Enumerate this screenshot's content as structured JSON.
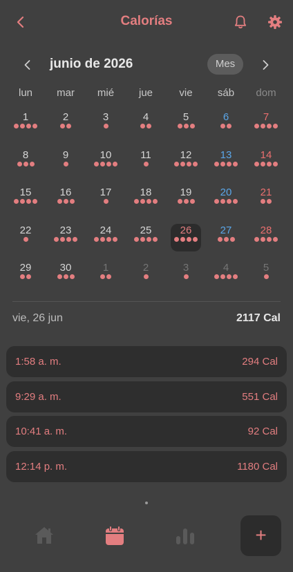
{
  "header": {
    "title": "Calorías",
    "back_icon": "chevron-left-icon",
    "bell_icon": "bell-icon",
    "gear_icon": "gear-icon",
    "accent": "#e37e80"
  },
  "calendar": {
    "month_label": "junio de 2026",
    "view_toggle": "Mes",
    "weekdays": [
      "lun",
      "mar",
      "mié",
      "jue",
      "vie",
      "sáb",
      "dom"
    ],
    "selected_day": 26,
    "weeks": [
      [
        {
          "d": "1",
          "dots": 4
        },
        {
          "d": "2",
          "dots": 2
        },
        {
          "d": "3",
          "dots": 1
        },
        {
          "d": "4",
          "dots": 2
        },
        {
          "d": "5",
          "dots": 3
        },
        {
          "d": "6",
          "dots": 2
        },
        {
          "d": "7",
          "dots": 4
        }
      ],
      [
        {
          "d": "8",
          "dots": 3
        },
        {
          "d": "9",
          "dots": 1
        },
        {
          "d": "10",
          "dots": 4
        },
        {
          "d": "11",
          "dots": 1
        },
        {
          "d": "12",
          "dots": 4
        },
        {
          "d": "13",
          "dots": 4
        },
        {
          "d": "14",
          "dots": 4
        }
      ],
      [
        {
          "d": "15",
          "dots": 4
        },
        {
          "d": "16",
          "dots": 3
        },
        {
          "d": "17",
          "dots": 1
        },
        {
          "d": "18",
          "dots": 4
        },
        {
          "d": "19",
          "dots": 3
        },
        {
          "d": "20",
          "dots": 4
        },
        {
          "d": "21",
          "dots": 2
        }
      ],
      [
        {
          "d": "22",
          "dots": 1
        },
        {
          "d": "23",
          "dots": 4
        },
        {
          "d": "24",
          "dots": 4
        },
        {
          "d": "25",
          "dots": 4
        },
        {
          "d": "26",
          "dots": 4
        },
        {
          "d": "27",
          "dots": 3
        },
        {
          "d": "28",
          "dots": 4
        }
      ],
      [
        {
          "d": "29",
          "dots": 2
        },
        {
          "d": "30",
          "dots": 3
        },
        {
          "d": "1",
          "dots": 2,
          "other": true
        },
        {
          "d": "2",
          "dots": 1,
          "other": true
        },
        {
          "d": "3",
          "dots": 1,
          "other": true
        },
        {
          "d": "4",
          "dots": 4,
          "other": true
        },
        {
          "d": "5",
          "dots": 1,
          "other": true
        }
      ]
    ],
    "colors": {
      "weekday": "#d6d6d6",
      "saturday": "#5aa6e8",
      "sunday": "#ea6f6f",
      "other_month": "#757575",
      "dot": "#e37e80"
    }
  },
  "summary": {
    "date": "vie, 26 jun",
    "total": "2117 Cal"
  },
  "entries": [
    {
      "time": "1:58 a. m.",
      "cal": "294 Cal"
    },
    {
      "time": "9:29 a. m.",
      "cal": "551 Cal"
    },
    {
      "time": "10:41 a. m.",
      "cal": "92 Cal"
    },
    {
      "time": "12:14 p. m.",
      "cal": "1180 Cal"
    }
  ],
  "tabbar": {
    "tabs": [
      {
        "icon": "home-icon",
        "active": false
      },
      {
        "icon": "calendar-icon",
        "active": true
      },
      {
        "icon": "bar-chart-icon",
        "active": false
      }
    ],
    "add_label": "+"
  }
}
